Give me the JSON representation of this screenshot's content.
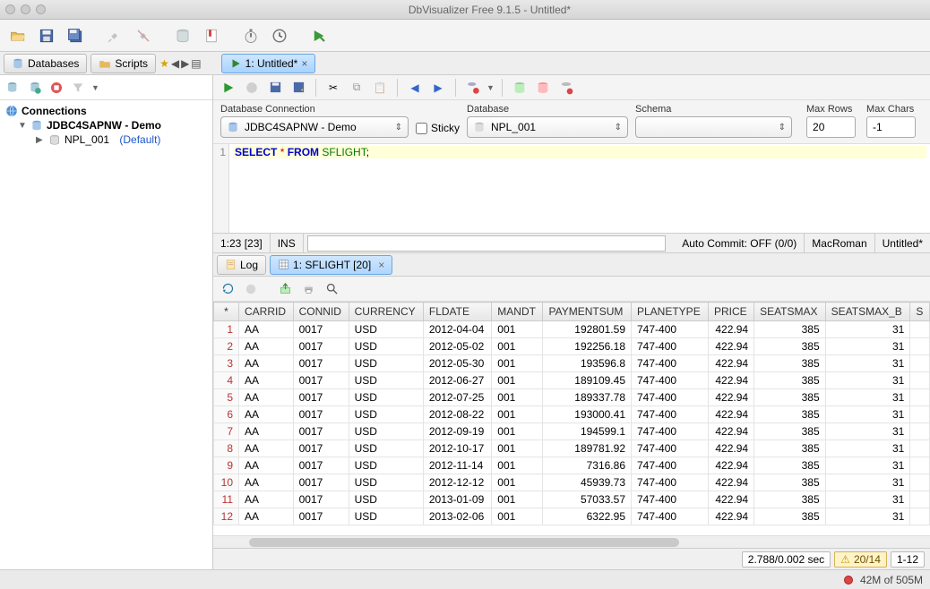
{
  "window": {
    "title": "DbVisualizer Free 9.1.5 - Untitled*"
  },
  "navtabs": {
    "databases": "Databases",
    "scripts": "Scripts"
  },
  "script_tab": {
    "label": "1: Untitled*"
  },
  "tree": {
    "root": "Connections",
    "conn": "JDBC4SAPNW - Demo",
    "db": "NPL_001",
    "default": "(Default)"
  },
  "conn_row": {
    "db_conn_label": "Database Connection",
    "sticky_label": "Sticky",
    "database_label": "Database",
    "schema_label": "Schema",
    "maxrows_label": "Max Rows",
    "maxchars_label": "Max Chars",
    "db_conn_value": "JDBC4SAPNW - Demo",
    "database_value": "NPL_001",
    "schema_value": "",
    "maxrows_value": "20",
    "maxchars_value": "-1"
  },
  "editor": {
    "line_no": "1",
    "code_plain": "SELECT * FROM SFLIGHT;"
  },
  "status": {
    "pos": "1:23 [23]",
    "ins": "INS",
    "autocommit": "Auto Commit: OFF (0/0)",
    "encoding": "MacRoman",
    "doc": "Untitled*"
  },
  "result_tabs": {
    "log": "Log",
    "result": "1: SFLIGHT [20]"
  },
  "grid": {
    "columns": [
      "CARRID",
      "CONNID",
      "CURRENCY",
      "FLDATE",
      "MANDT",
      "PAYMENTSUM",
      "PLANETYPE",
      "PRICE",
      "SEATSMAX",
      "SEATSMAX_B",
      "S"
    ],
    "rows": [
      [
        "AA",
        "0017",
        "USD",
        "2012-04-04",
        "001",
        "192801.59",
        "747-400",
        "422.94",
        "385",
        "31",
        ""
      ],
      [
        "AA",
        "0017",
        "USD",
        "2012-05-02",
        "001",
        "192256.18",
        "747-400",
        "422.94",
        "385",
        "31",
        ""
      ],
      [
        "AA",
        "0017",
        "USD",
        "2012-05-30",
        "001",
        "193596.8",
        "747-400",
        "422.94",
        "385",
        "31",
        ""
      ],
      [
        "AA",
        "0017",
        "USD",
        "2012-06-27",
        "001",
        "189109.45",
        "747-400",
        "422.94",
        "385",
        "31",
        ""
      ],
      [
        "AA",
        "0017",
        "USD",
        "2012-07-25",
        "001",
        "189337.78",
        "747-400",
        "422.94",
        "385",
        "31",
        ""
      ],
      [
        "AA",
        "0017",
        "USD",
        "2012-08-22",
        "001",
        "193000.41",
        "747-400",
        "422.94",
        "385",
        "31",
        ""
      ],
      [
        "AA",
        "0017",
        "USD",
        "2012-09-19",
        "001",
        "194599.1",
        "747-400",
        "422.94",
        "385",
        "31",
        ""
      ],
      [
        "AA",
        "0017",
        "USD",
        "2012-10-17",
        "001",
        "189781.92",
        "747-400",
        "422.94",
        "385",
        "31",
        ""
      ],
      [
        "AA",
        "0017",
        "USD",
        "2012-11-14",
        "001",
        "7316.86",
        "747-400",
        "422.94",
        "385",
        "31",
        ""
      ],
      [
        "AA",
        "0017",
        "USD",
        "2012-12-12",
        "001",
        "45939.73",
        "747-400",
        "422.94",
        "385",
        "31",
        ""
      ],
      [
        "AA",
        "0017",
        "USD",
        "2013-01-09",
        "001",
        "57033.57",
        "747-400",
        "422.94",
        "385",
        "31",
        ""
      ],
      [
        "AA",
        "0017",
        "USD",
        "2013-02-06",
        "001",
        "6322.95",
        "747-400",
        "422.94",
        "385",
        "31",
        ""
      ]
    ],
    "numeric_cols": [
      5,
      7,
      8,
      9
    ]
  },
  "footer": {
    "time": "2.788/0.002 sec",
    "warn": "20/14",
    "range": "1-12"
  },
  "appfooter": {
    "mem": "42M of 505M"
  }
}
